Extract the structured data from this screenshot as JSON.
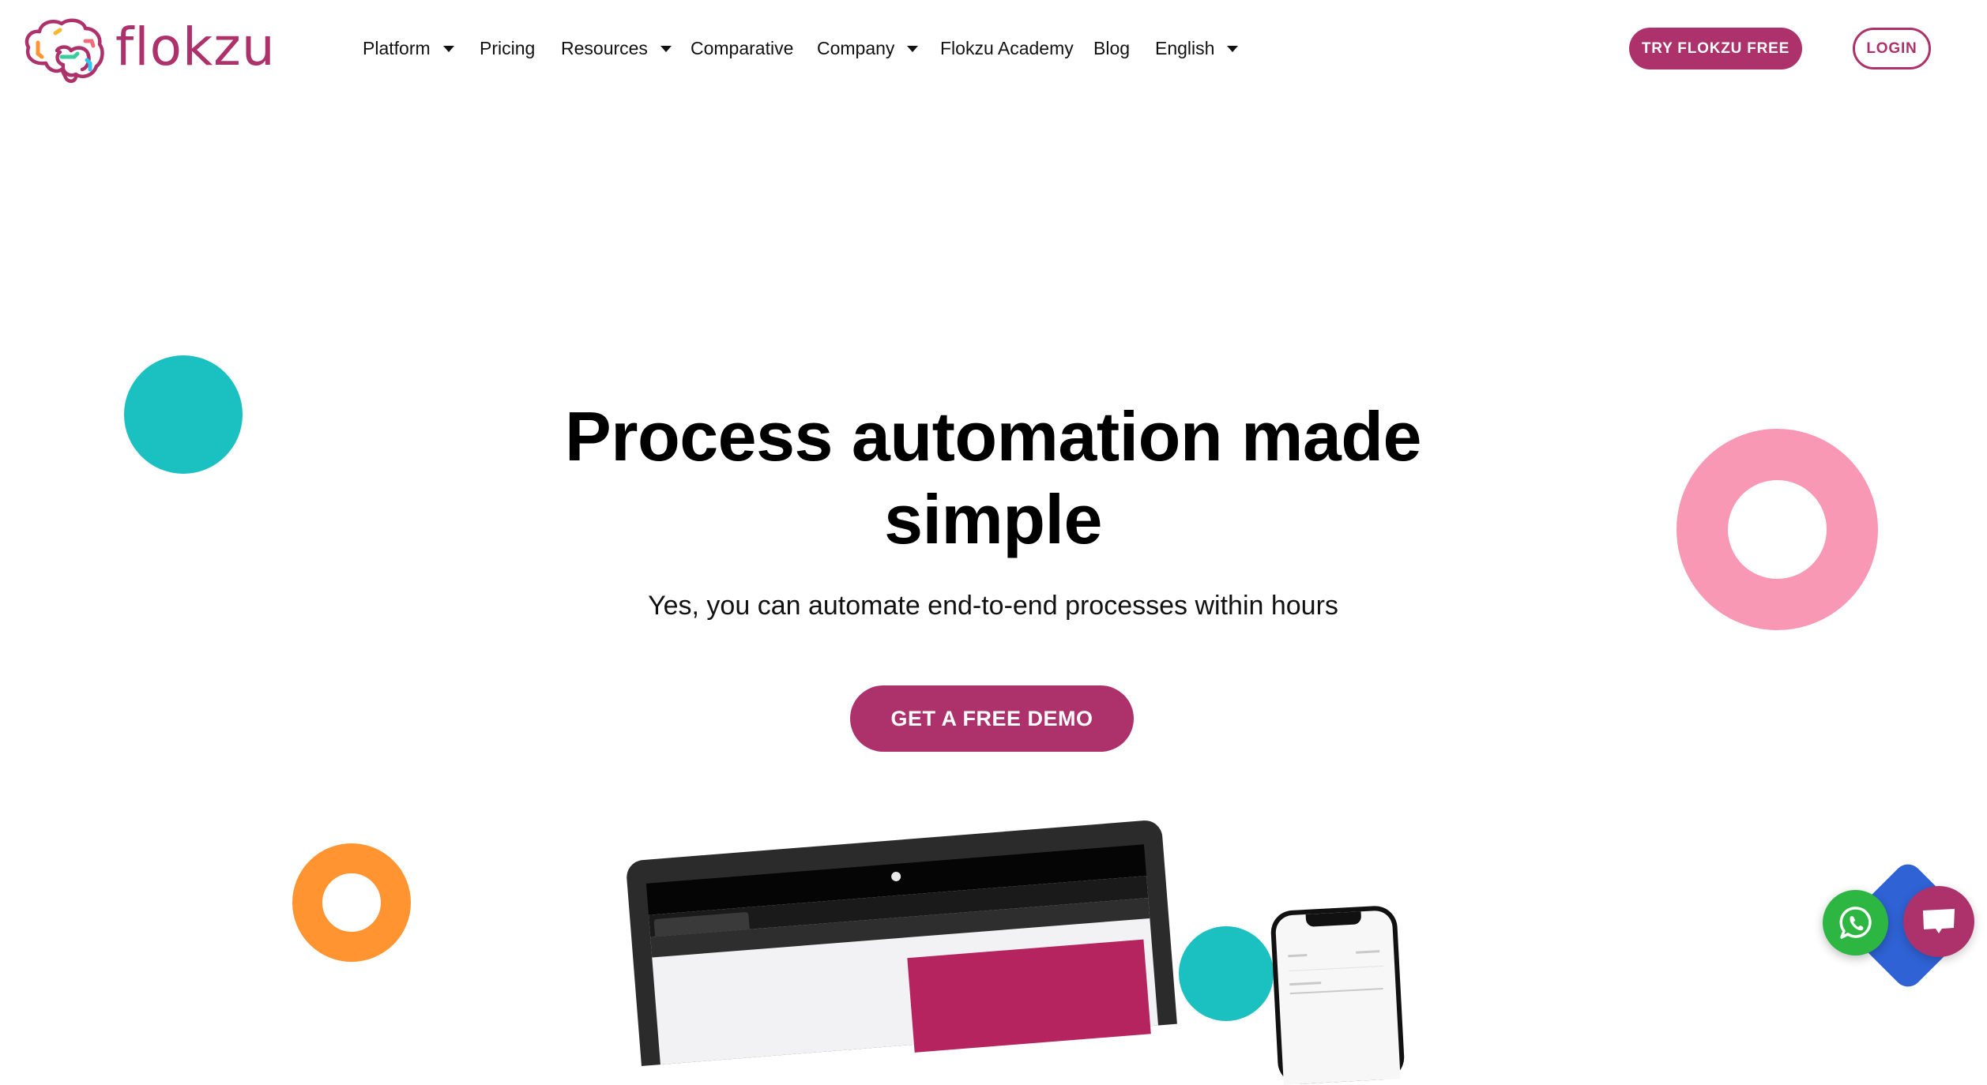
{
  "brand": {
    "name": "flokzu",
    "logo_icon": "brain-logo-icon",
    "colors": {
      "primary": "#AD326B",
      "teal": "#1BC0C0",
      "pink": "#F998B4",
      "orange": "#FF9430",
      "blue": "#2F62D4",
      "whatsapp_green": "#2DB742"
    }
  },
  "nav": {
    "items": [
      {
        "label": "Platform",
        "has_dropdown": true
      },
      {
        "label": "Pricing",
        "has_dropdown": false
      },
      {
        "label": "Resources",
        "has_dropdown": true
      },
      {
        "label": "Comparative",
        "has_dropdown": false
      },
      {
        "label": "Company",
        "has_dropdown": true
      },
      {
        "label": "Flokzu Academy",
        "has_dropdown": false
      },
      {
        "label": "Blog",
        "has_dropdown": false
      },
      {
        "label": "English",
        "has_dropdown": true
      }
    ],
    "try_free_label": "TRY FLOKZU FREE",
    "login_label": "LOGIN"
  },
  "hero": {
    "title_line1": "Process automation made",
    "title_line2": "simple",
    "subtitle": "Yes, you can automate end-to-end processes within hours",
    "cta_label": "GET A FREE DEMO"
  },
  "widgets": {
    "whatsapp_icon": "whatsapp-icon",
    "chat_icon": "chat-bubble-icon"
  }
}
